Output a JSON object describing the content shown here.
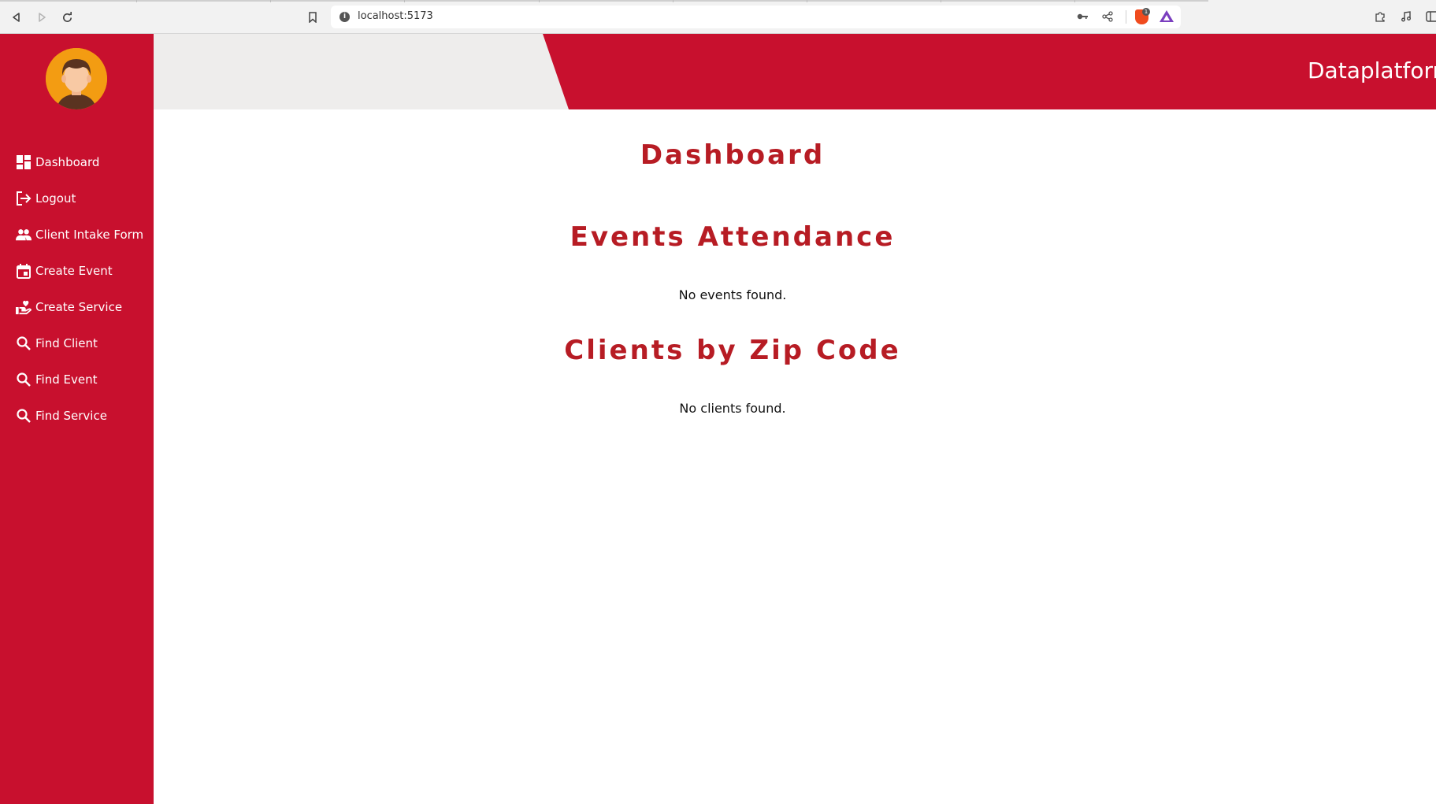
{
  "browser": {
    "url": "localhost:5173",
    "brave_badge_count": "1"
  },
  "sidebar": {
    "items": [
      {
        "label": "Dashboard",
        "icon": "dashboard-icon"
      },
      {
        "label": "Logout",
        "icon": "logout-icon"
      },
      {
        "label": "Client Intake Form",
        "icon": "people-icon"
      },
      {
        "label": "Create Event",
        "icon": "calendar-icon"
      },
      {
        "label": "Create Service",
        "icon": "volunteer-heart-icon"
      },
      {
        "label": "Find Client",
        "icon": "search-icon"
      },
      {
        "label": "Find Event",
        "icon": "search-icon"
      },
      {
        "label": "Find Service",
        "icon": "search-icon"
      }
    ]
  },
  "header": {
    "title": "Dataplatform"
  },
  "main": {
    "page_title": "Dashboard",
    "events_heading": "Events Attendance",
    "events_empty": "No events found.",
    "clients_heading": "Clients by Zip Code",
    "clients_empty": "No clients found."
  },
  "colors": {
    "brand_red": "#c8102e",
    "heading_red": "#b71c24",
    "banner_grey": "#eeedec"
  }
}
